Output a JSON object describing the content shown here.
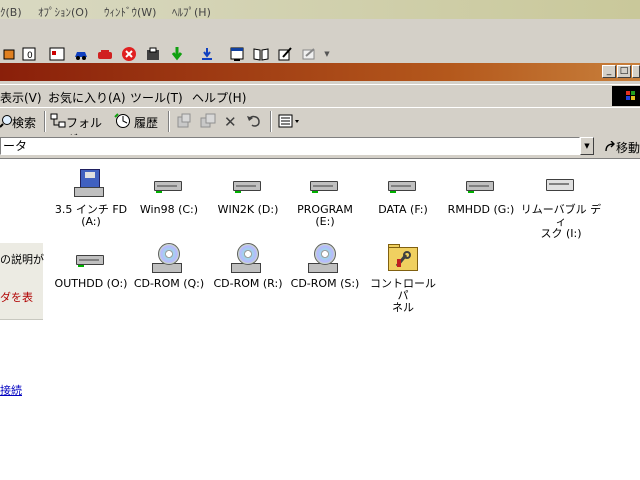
{
  "outer_window": {
    "menu": [
      "ｸ(B)",
      "ｵﾌﾟｼｮﾝ(O)",
      "ｳｨﾝﾄﾞｳ(W)",
      "ﾍﾙﾌﾟ(H)"
    ],
    "toolbar_icons": [
      "lock-icon",
      "info-icon",
      "calendar-icon",
      "car-icon",
      "phone-icon",
      "stop-icon",
      "tools-icon",
      "download-icon",
      "save-icon",
      "window-icon",
      "book-icon",
      "edit-icon",
      "dropdown-icon"
    ]
  },
  "explorer": {
    "title_buttons": {
      "minimize": "_",
      "restore": "□"
    },
    "menu": {
      "view": "表示(V)",
      "favorites": "お気に入り(A)",
      "tools": "ツール(T)",
      "help": "ヘルプ(H)"
    },
    "toolbar": {
      "search": "検索",
      "folders": "フォルダ",
      "history": "履歴"
    },
    "address": {
      "value": "ータ",
      "go": "移動"
    },
    "left_pane": {
      "line1": "の説明が",
      "line2": "ダを表",
      "link": "接続"
    },
    "items": [
      {
        "label": "3.5 インチ FD\n(A:)",
        "type": "floppy"
      },
      {
        "label": "Win98 (C:)",
        "type": "drive"
      },
      {
        "label": "WIN2K (D:)",
        "type": "drive"
      },
      {
        "label": "PROGRAM\n(E:)",
        "type": "drive"
      },
      {
        "label": "DATA (F:)",
        "type": "drive"
      },
      {
        "label": "RMHDD (G:)",
        "type": "drive"
      },
      {
        "label": "リムーバブル ディ\nスク (I:)",
        "type": "removable"
      },
      {
        "label": "OUTHDD (O:)",
        "type": "drive"
      },
      {
        "label": "CD-ROM (Q:)",
        "type": "cdrom"
      },
      {
        "label": "CD-ROM (R:)",
        "type": "cdrom"
      },
      {
        "label": "CD-ROM (S:)",
        "type": "cdrom"
      },
      {
        "label": "コントロール パ\nネル",
        "type": "control-panel"
      }
    ]
  }
}
